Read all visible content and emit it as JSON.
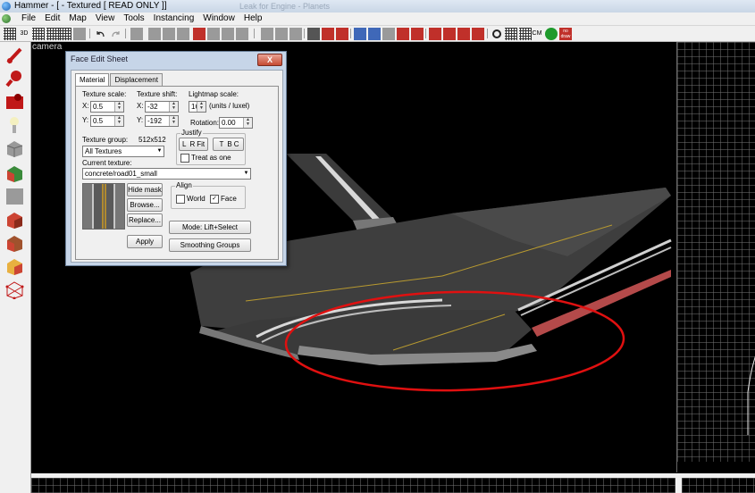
{
  "window": {
    "title": "Hammer - [ - Textured [ READ ONLY ]]",
    "ghost_title": "Leak for Engine - Planets"
  },
  "menu": [
    "File",
    "Edit",
    "Map",
    "View",
    "Tools",
    "Instancing",
    "Window",
    "Help"
  ],
  "toolbar": {
    "label_3d": "3D",
    "label_cm": "CM",
    "label_nodraw": "no draw"
  },
  "viewport": {
    "label": "camera"
  },
  "dialog": {
    "title": "Face Edit Sheet",
    "close_label": "X",
    "tabs": [
      "Material",
      "Displacement"
    ],
    "texture_scale_label": "Texture scale:",
    "texture_shift_label": "Texture shift:",
    "lightmap_scale_label": "Lightmap scale:",
    "x_label": "X:",
    "y_label": "Y:",
    "scale_x": "0.5",
    "scale_y": "0.5",
    "shift_x": "-32",
    "shift_y": "-192",
    "lightmap_value": "16",
    "lightmap_units": "(units / luxel)",
    "rotation_label": "Rotation:",
    "rotation_value": "0.00",
    "justify_label": "Justify",
    "justify_buttons": [
      "L",
      "R",
      "Fit",
      "T",
      "B",
      "C"
    ],
    "treat_as_one": "Treat as one",
    "texture_group_label": "Texture group:",
    "texture_size": "512x512",
    "texture_group_value": "All Textures",
    "current_texture_label": "Current texture:",
    "current_texture_value": "concrete/road01_small",
    "hide_mask": "Hide mask",
    "browse": "Browse...",
    "replace": "Replace...",
    "apply": "Apply",
    "align_label": "Align",
    "align_world": "World",
    "align_face": "Face",
    "align_world_checked": false,
    "align_face_checked": true,
    "mode_button": "Mode: Lift+Select",
    "smoothing_groups": "Smoothing Groups"
  },
  "colors": {
    "highlight_ellipse": "#e01010",
    "road": "#3a3a3a",
    "dialog_frame": "#c6d5e8"
  }
}
